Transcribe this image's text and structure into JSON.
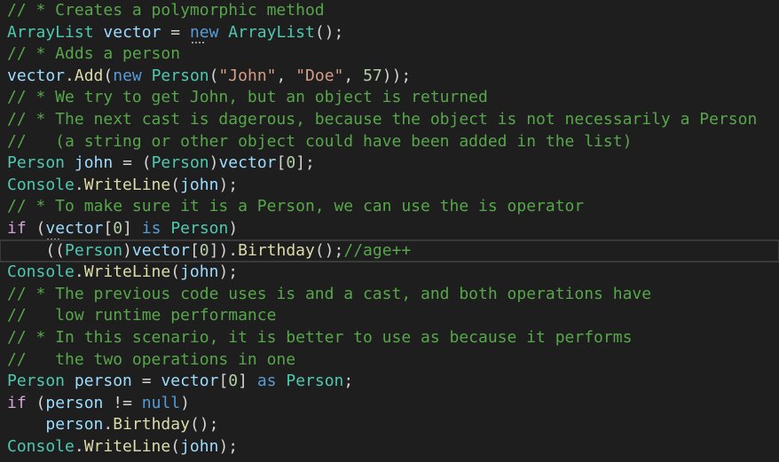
{
  "editor": {
    "lines": [
      [
        {
          "t": "// * Creates a polymorphic method",
          "k": "comment"
        }
      ],
      [
        {
          "t": "ArrayList",
          "k": "type"
        },
        {
          "t": " ",
          "k": "punc"
        },
        {
          "t": "vector",
          "k": "var"
        },
        {
          "t": " = ",
          "k": "punc"
        },
        {
          "t": "new",
          "k": "key"
        },
        {
          "t": " ",
          "k": "punc"
        },
        {
          "t": "ArrayList",
          "k": "type"
        },
        {
          "t": "();",
          "k": "punc"
        }
      ],
      [
        {
          "t": "// * Adds a person",
          "k": "comment"
        }
      ],
      [
        {
          "t": "vector",
          "k": "var"
        },
        {
          "t": ".",
          "k": "punc"
        },
        {
          "t": "Add",
          "k": "meth"
        },
        {
          "t": "(",
          "k": "punc"
        },
        {
          "t": "new",
          "k": "key"
        },
        {
          "t": " ",
          "k": "punc"
        },
        {
          "t": "Person",
          "k": "type"
        },
        {
          "t": "(",
          "k": "punc"
        },
        {
          "t": "\"John\"",
          "k": "str"
        },
        {
          "t": ", ",
          "k": "punc"
        },
        {
          "t": "\"Doe\"",
          "k": "str"
        },
        {
          "t": ", ",
          "k": "punc"
        },
        {
          "t": "57",
          "k": "num"
        },
        {
          "t": "));",
          "k": "punc"
        }
      ],
      [
        {
          "t": "// * We try to get John, but an object is returned",
          "k": "comment"
        }
      ],
      [
        {
          "t": "// * The next cast is dagerous, because the object is not necessarily a Person",
          "k": "comment"
        }
      ],
      [
        {
          "t": "//   (a string or other object could have been added in the list)",
          "k": "comment"
        }
      ],
      [
        {
          "t": "Person",
          "k": "type"
        },
        {
          "t": " ",
          "k": "punc"
        },
        {
          "t": "john",
          "k": "var"
        },
        {
          "t": " = (",
          "k": "punc"
        },
        {
          "t": "Person",
          "k": "type"
        },
        {
          "t": ")",
          "k": "punc"
        },
        {
          "t": "vector",
          "k": "var"
        },
        {
          "t": "[",
          "k": "punc"
        },
        {
          "t": "0",
          "k": "num"
        },
        {
          "t": "];",
          "k": "punc"
        }
      ],
      [
        {
          "t": "Console",
          "k": "type"
        },
        {
          "t": ".",
          "k": "punc"
        },
        {
          "t": "WriteLine",
          "k": "meth"
        },
        {
          "t": "(",
          "k": "punc"
        },
        {
          "t": "john",
          "k": "var"
        },
        {
          "t": ");",
          "k": "punc"
        }
      ],
      [
        {
          "t": "// * To make sure it is a Person, we can use the is operator",
          "k": "comment"
        }
      ],
      [
        {
          "t": "if",
          "k": "ctrl"
        },
        {
          "t": " (",
          "k": "punc"
        },
        {
          "t": "vector",
          "k": "var"
        },
        {
          "t": "[",
          "k": "punc"
        },
        {
          "t": "0",
          "k": "num"
        },
        {
          "t": "] ",
          "k": "punc"
        },
        {
          "t": "is",
          "k": "key"
        },
        {
          "t": " ",
          "k": "punc"
        },
        {
          "t": "Person",
          "k": "type"
        },
        {
          "t": ")",
          "k": "punc"
        }
      ],
      [
        {
          "t": "    ((",
          "k": "punc"
        },
        {
          "t": "Person",
          "k": "type"
        },
        {
          "t": ")",
          "k": "punc"
        },
        {
          "t": "vector",
          "k": "var"
        },
        {
          "t": "[",
          "k": "punc"
        },
        {
          "t": "0",
          "k": "num"
        },
        {
          "t": "]).",
          "k": "punc"
        },
        {
          "t": "Birthday",
          "k": "meth"
        },
        {
          "t": "();",
          "k": "punc"
        },
        {
          "t": "//age++",
          "k": "comment"
        }
      ],
      [
        {
          "t": "Console",
          "k": "type"
        },
        {
          "t": ".",
          "k": "punc"
        },
        {
          "t": "WriteLine",
          "k": "meth"
        },
        {
          "t": "(",
          "k": "punc"
        },
        {
          "t": "john",
          "k": "var"
        },
        {
          "t": ");",
          "k": "punc"
        }
      ],
      [
        {
          "t": "// * The previous code uses is and a cast, and both operations have",
          "k": "comment"
        }
      ],
      [
        {
          "t": "//   low runtime performance",
          "k": "comment"
        }
      ],
      [
        {
          "t": "// * In this scenario, it is better to use as because it performs",
          "k": "comment"
        }
      ],
      [
        {
          "t": "//   the two operations in one",
          "k": "comment"
        }
      ],
      [
        {
          "t": "Person",
          "k": "type"
        },
        {
          "t": " ",
          "k": "punc"
        },
        {
          "t": "person",
          "k": "var"
        },
        {
          "t": " = ",
          "k": "punc"
        },
        {
          "t": "vector",
          "k": "var"
        },
        {
          "t": "[",
          "k": "punc"
        },
        {
          "t": "0",
          "k": "num"
        },
        {
          "t": "] ",
          "k": "punc"
        },
        {
          "t": "as",
          "k": "key"
        },
        {
          "t": " ",
          "k": "punc"
        },
        {
          "t": "Person",
          "k": "type"
        },
        {
          "t": ";",
          "k": "punc"
        }
      ],
      [
        {
          "t": "if",
          "k": "ctrl"
        },
        {
          "t": " (",
          "k": "punc"
        },
        {
          "t": "person",
          "k": "var"
        },
        {
          "t": " != ",
          "k": "punc"
        },
        {
          "t": "null",
          "k": "key"
        },
        {
          "t": ")",
          "k": "punc"
        }
      ],
      [
        {
          "t": "    ",
          "k": "punc"
        },
        {
          "t": "person",
          "k": "var"
        },
        {
          "t": ".",
          "k": "punc"
        },
        {
          "t": "Birthday",
          "k": "meth"
        },
        {
          "t": "();",
          "k": "punc"
        }
      ],
      [
        {
          "t": "Console",
          "k": "type"
        },
        {
          "t": ".",
          "k": "punc"
        },
        {
          "t": "WriteLine",
          "k": "meth"
        },
        {
          "t": "(",
          "k": "punc"
        },
        {
          "t": "john",
          "k": "var"
        },
        {
          "t": ");",
          "k": "punc"
        }
      ]
    ],
    "current_line_index": 11,
    "suggestion_dot_lines": [
      1,
      10
    ],
    "colors": {
      "background": "#1e1e1e",
      "comment": "#57a64a",
      "type": "#4ec9b0",
      "variable": "#9cdcfe",
      "keyword": "#569cd6",
      "control": "#d8a0df",
      "string": "#d69d85",
      "number": "#b5cea8",
      "method": "#dcdcaa",
      "punctuation": "#d4d4d4"
    }
  }
}
